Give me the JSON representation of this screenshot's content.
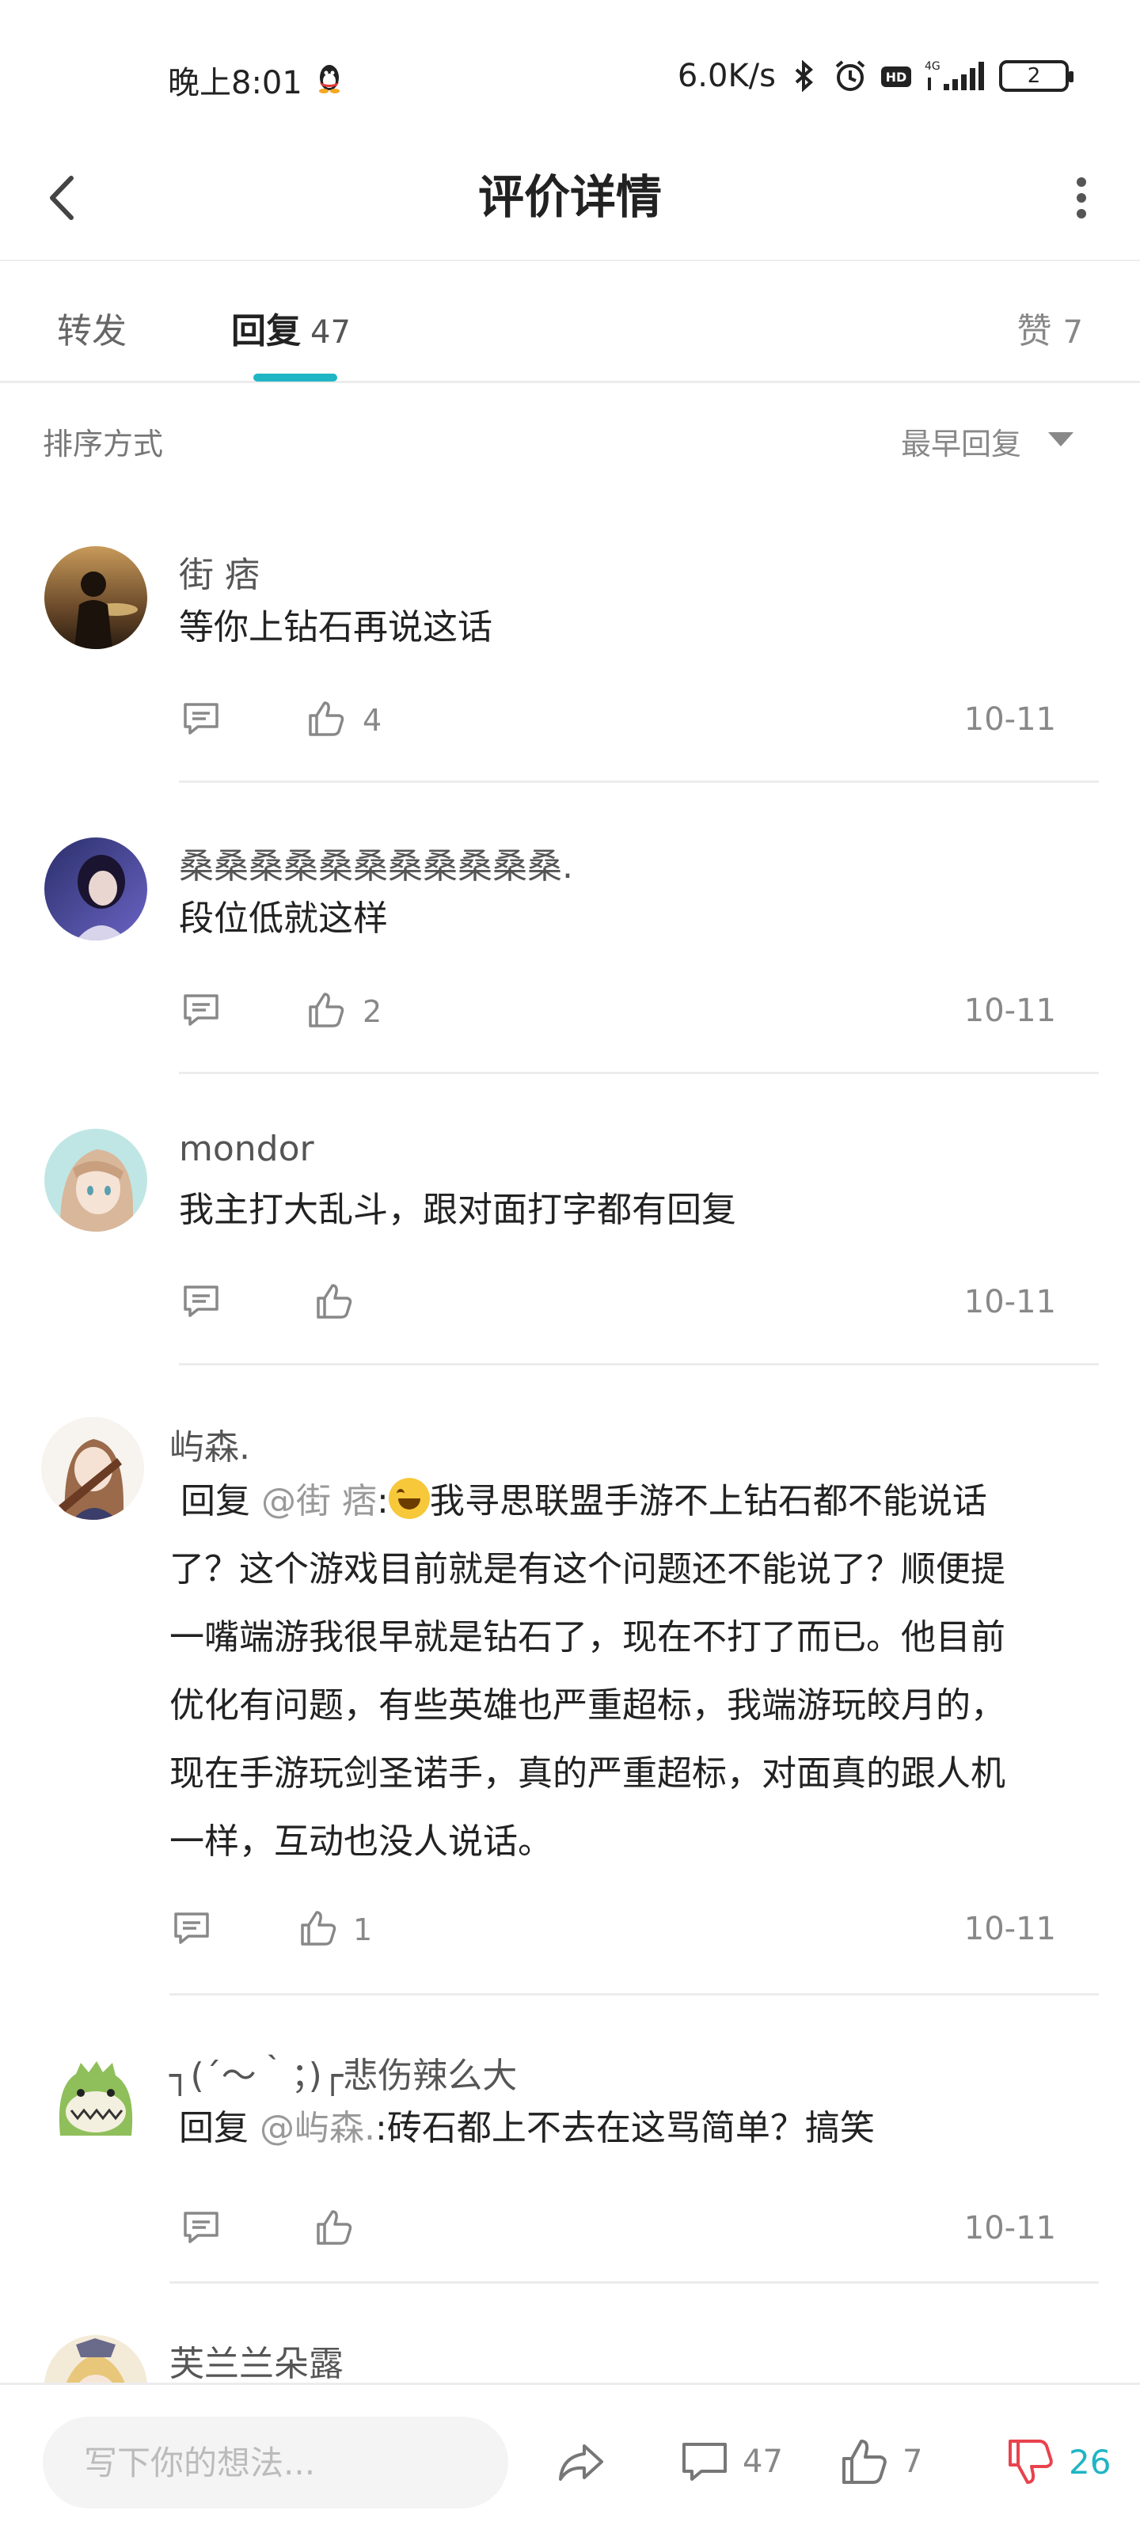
{
  "status_bar": {
    "time": "晚上8:01",
    "net_speed": "6.0K/s",
    "battery": "2"
  },
  "header": {
    "title": "评价详情"
  },
  "tabs": {
    "forward_label": "转发",
    "reply_label": "回复",
    "reply_count": "47",
    "like_label": "赞",
    "like_count": "7"
  },
  "sort": {
    "label": "排序方式",
    "value": "最早回复"
  },
  "comments": [
    {
      "author": "街 痞",
      "body": "等你上钻石再说这话",
      "likes": "4",
      "date": "10-11"
    },
    {
      "author": "桑桑桑桑桑桑桑桑桑桑桑.",
      "body": "段位低就这样",
      "likes": "2",
      "date": "10-11"
    },
    {
      "author": "mondor",
      "body": "我主打大乱斗，跟对面打字都有回复",
      "likes": "",
      "date": "10-11"
    },
    {
      "author": "屿森.",
      "reply_prefix": "回复",
      "mention": "@街 痞",
      "body_line1": ":",
      "body_line1_rest": "我寻思联盟手游不上钻石都不能说话",
      "body_line2": "了？这个游戏目前就是有这个问题还不能说了？顺便提",
      "body_line3": "一嘴端游我很早就是钻石了，现在不打了而已。他目前",
      "body_line4": "优化有问题，有些英雄也严重超标，我端游玩皎月的，",
      "body_line5": "现在手游玩剑圣诺手，真的严重超标，对面真的跟人机",
      "body_line6": "一样，互动也没人说话。",
      "likes": "1",
      "date": "10-11"
    },
    {
      "author": "┐(´～｀；)┌悲伤辣么大",
      "reply_prefix": "回复",
      "mention": "@屿森.",
      "body": ":砖石都上不去在这骂简单？搞笑",
      "likes": "",
      "date": "10-11"
    },
    {
      "author": "芙兰兰朵露"
    }
  ],
  "bottom_bar": {
    "input_placeholder": "写下你的想法...",
    "comment_count": "47",
    "like_count": "7",
    "dislike_count": "26"
  },
  "colors": {
    "accent": "#1fb5c4",
    "dislike": "#e8434e"
  }
}
